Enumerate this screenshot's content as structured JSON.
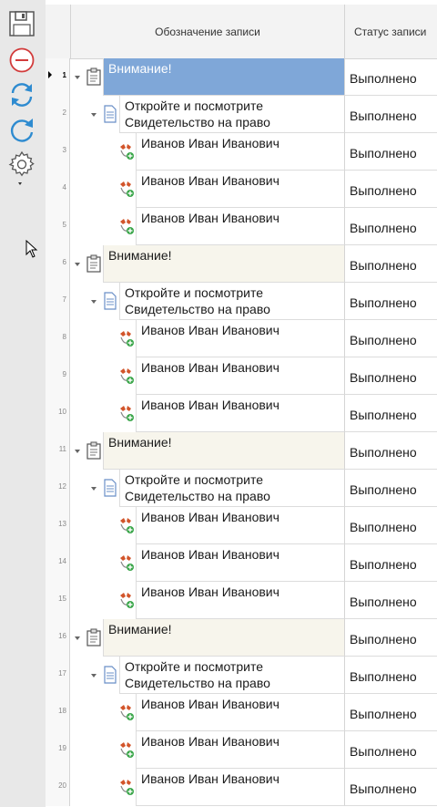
{
  "toolbar": {
    "buttons": [
      {
        "name": "save-icon"
      },
      {
        "name": "cancel-icon"
      },
      {
        "name": "refresh-icon"
      },
      {
        "name": "redo-icon"
      },
      {
        "name": "settings-icon"
      }
    ]
  },
  "grid": {
    "columns": {
      "name": "Обозначение записи",
      "status": "Статус записи"
    },
    "rows": [
      {
        "num": "1",
        "type": "notice",
        "text": "Внимание!",
        "status": "Выполнено",
        "selected": true
      },
      {
        "num": "2",
        "type": "doc",
        "text": "Откройте и посмотрите Свидетельство на право",
        "status": "Выполнено"
      },
      {
        "num": "3",
        "type": "person",
        "text": "Иванов Иван Иванович",
        "status": "Выполнено"
      },
      {
        "num": "4",
        "type": "person",
        "text": "Иванов Иван Иванович",
        "status": "Выполнено"
      },
      {
        "num": "5",
        "type": "person",
        "text": "Иванов Иван Иванович",
        "status": "Выполнено"
      },
      {
        "num": "6",
        "type": "notice",
        "text": "Внимание!",
        "status": "Выполнено"
      },
      {
        "num": "7",
        "type": "doc",
        "text": "Откройте и посмотрите Свидетельство на право",
        "status": "Выполнено"
      },
      {
        "num": "8",
        "type": "person",
        "text": "Иванов Иван Иванович",
        "status": "Выполнено"
      },
      {
        "num": "9",
        "type": "person",
        "text": "Иванов Иван Иванович",
        "status": "Выполнено"
      },
      {
        "num": "10",
        "type": "person",
        "text": "Иванов Иван Иванович",
        "status": "Выполнено"
      },
      {
        "num": "11",
        "type": "notice",
        "text": "Внимание!",
        "status": "Выполнено"
      },
      {
        "num": "12",
        "type": "doc",
        "text": "Откройте и посмотрите Свидетельство на право",
        "status": "Выполнено"
      },
      {
        "num": "13",
        "type": "person",
        "text": "Иванов Иван Иванович",
        "status": "Выполнено"
      },
      {
        "num": "14",
        "type": "person",
        "text": "Иванов Иван Иванович",
        "status": "Выполнено"
      },
      {
        "num": "15",
        "type": "person",
        "text": "Иванов Иван Иванович",
        "status": "Выполнено"
      },
      {
        "num": "16",
        "type": "notice",
        "text": "Внимание!",
        "status": "Выполнено"
      },
      {
        "num": "17",
        "type": "doc",
        "text": "Откройте и посмотрите Свидетельство на право",
        "status": "Выполнено"
      },
      {
        "num": "18",
        "type": "person",
        "text": "Иванов Иван Иванович",
        "status": "Выполнено"
      },
      {
        "num": "19",
        "type": "person",
        "text": "Иванов Иван Иванович",
        "status": "Выполнено"
      },
      {
        "num": "20",
        "type": "person",
        "text": "Иванов Иван Иванович",
        "status": "Выполнено"
      }
    ]
  }
}
